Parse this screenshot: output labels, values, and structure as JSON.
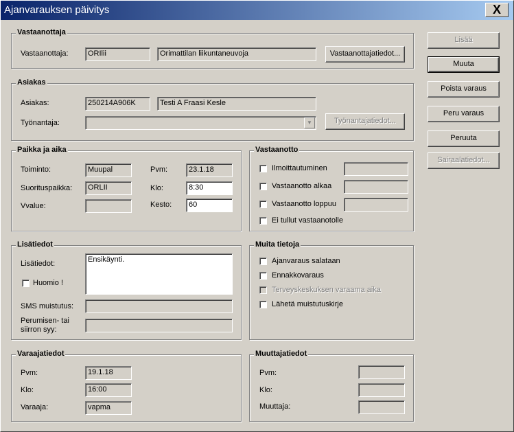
{
  "window": {
    "title": "Ajanvarauksen päivitys",
    "close_label": "X"
  },
  "vastaanottaja": {
    "title": "Vastaanottaja",
    "label": "Vastaanottaja:",
    "code": "ORIlii",
    "name": "Orimattilan liikuntaneuvoja",
    "details_button": "Vastaanottajatiedot..."
  },
  "asiakas": {
    "title": "Asiakas",
    "label": "Asiakas:",
    "id": "250214A906K",
    "name": "Testi A Fraasi Kesle",
    "employer_label": "Työnantaja:",
    "employer_value": "",
    "employer_button": "Työnantajatiedot..."
  },
  "paikka": {
    "title": "Paikka ja aika",
    "toiminto_label": "Toiminto:",
    "toiminto_value": "Muupal",
    "suorituspaikka_label": "Suorituspaikka:",
    "suorituspaikka_value": "ORLII",
    "vvalue_label": "Vvalue:",
    "vvalue_value": "",
    "pvm_label": "Pvm:",
    "pvm_value": "23.1.18",
    "klo_label": "Klo:",
    "klo_value": "8:30",
    "kesto_label": "Kesto:",
    "kesto_value": "60"
  },
  "vastaanotto": {
    "title": "Vastaanotto",
    "ilmoittautuminen": "Ilmoittautuminen",
    "alkaa": "Vastaanotto alkaa",
    "loppuu": "Vastaanotto loppuu",
    "ei_tullut": "Ei tullut vastaanotolle"
  },
  "lisatiedot": {
    "title": "Lisätiedot",
    "label": "Lisätiedot:",
    "value": "Ensikäynti.",
    "huomio": "Huomio !",
    "sms_label": "SMS muistutus:",
    "sms_value": "",
    "peruminen_label_1": "Perumisen- tai",
    "peruminen_label_2": "siirron syy:",
    "peruminen_value": ""
  },
  "muita": {
    "title": "Muita tietoja",
    "salataan": "Ajanvaraus salataan",
    "ennakko": "Ennakkovaraus",
    "terveys": "Terveyskeskuksen varaama aika",
    "laheta": "Lähetä muistutuskirje"
  },
  "varaaja": {
    "title": "Varaajatiedot",
    "pvm_label": "Pvm:",
    "pvm_value": "19.1.18",
    "klo_label": "Klo:",
    "klo_value": "16:00",
    "varaaja_label": "Varaaja:",
    "varaaja_value": "vapma"
  },
  "muuttaja": {
    "title": "Muuttajatiedot",
    "pvm_label": "Pvm:",
    "pvm_value": "",
    "klo_label": "Klo:",
    "klo_value": "",
    "muuttaja_label": "Muuttaja:",
    "muuttaja_value": ""
  },
  "buttons": {
    "lisaa": "Lisää",
    "muuta": "Muuta",
    "poista": "Poista varaus",
    "peru": "Peru varaus",
    "peruuta": "Peruuta",
    "sairaala": "Sairaalatiedot..."
  }
}
